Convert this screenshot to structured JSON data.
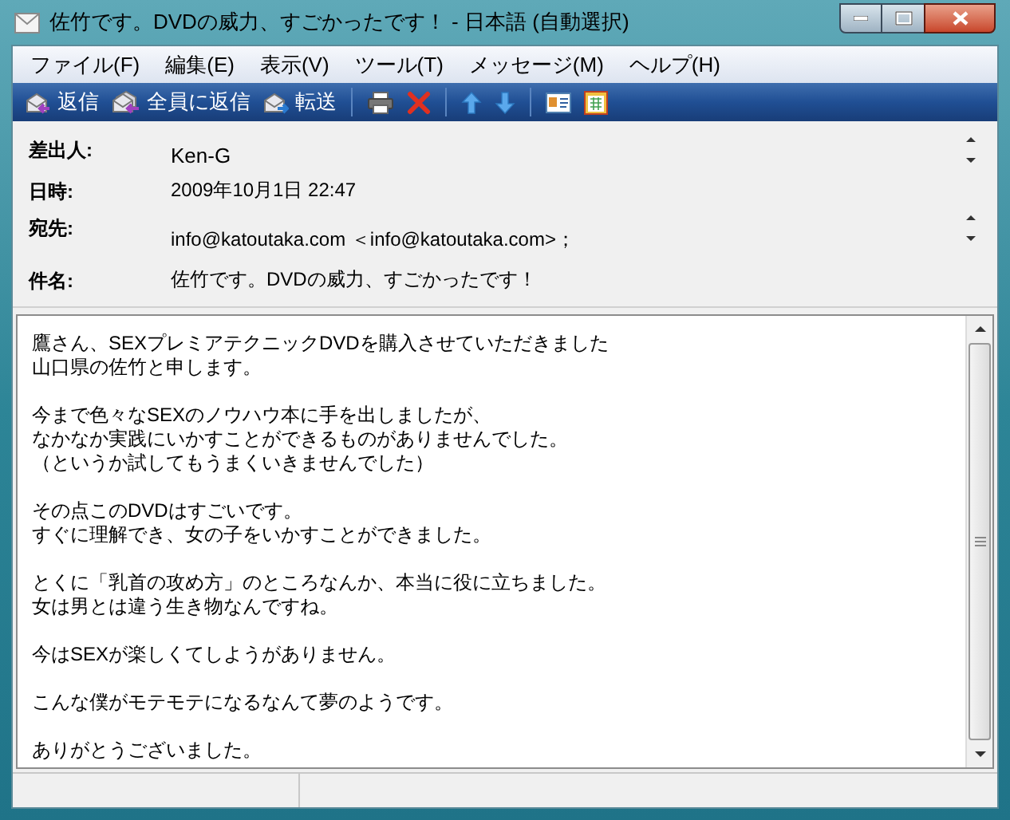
{
  "window": {
    "title": "佐竹です。DVDの威力、すごかったです！ - 日本語 (自動選択)"
  },
  "menu": [
    "ファイル(F)",
    "編集(E)",
    "表示(V)",
    "ツール(T)",
    "メッセージ(M)",
    "ヘルプ(H)"
  ],
  "toolbar": [
    {
      "kind": "reply",
      "label": "返信"
    },
    {
      "kind": "reply_all",
      "label": "全員に返信"
    },
    {
      "kind": "forward",
      "label": "転送"
    },
    {
      "kind": "separator"
    },
    {
      "kind": "print"
    },
    {
      "kind": "delete"
    },
    {
      "kind": "separator"
    },
    {
      "kind": "up"
    },
    {
      "kind": "down"
    },
    {
      "kind": "separator"
    },
    {
      "kind": "contact"
    },
    {
      "kind": "calendar"
    }
  ],
  "header": [
    {
      "label": "差出人:",
      "value": "Ken-G",
      "spinner": true
    },
    {
      "label": "日時:",
      "value": "2009年10月1日 22:47",
      "spinner": false
    },
    {
      "label": "宛先:",
      "value": "info@katoutaka.com ＜info@katoutaka.com>；",
      "spinner": true
    },
    {
      "label": "件名:",
      "value": "佐竹です。DVDの威力、すごかったです！",
      "spinner": false
    }
  ],
  "body": [
    [
      "鷹さん、SEXプレミアテクニックDVDを購入させていただきました",
      "山口県の佐竹と申します。"
    ],
    [
      "今まで色々なSEXのノウハウ本に手を出しましたが、",
      "なかなか実践にいかすことができるものがありませんでした。",
      "（というか試してもうまくいきませんでした）"
    ],
    [
      "その点このDVDはすごいです。",
      "すぐに理解でき、女の子をいかすことができました。"
    ],
    [
      "とくに「乳首の攻め方」のところなんか、本当に役に立ちました。",
      "女は男とは違う生き物なんですね。"
    ],
    [
      "今はSEXが楽しくてしようがありません。"
    ],
    [
      "こんな僕がモテモテになるなんて夢のようです。"
    ],
    [
      "ありがとうございました。"
    ]
  ]
}
